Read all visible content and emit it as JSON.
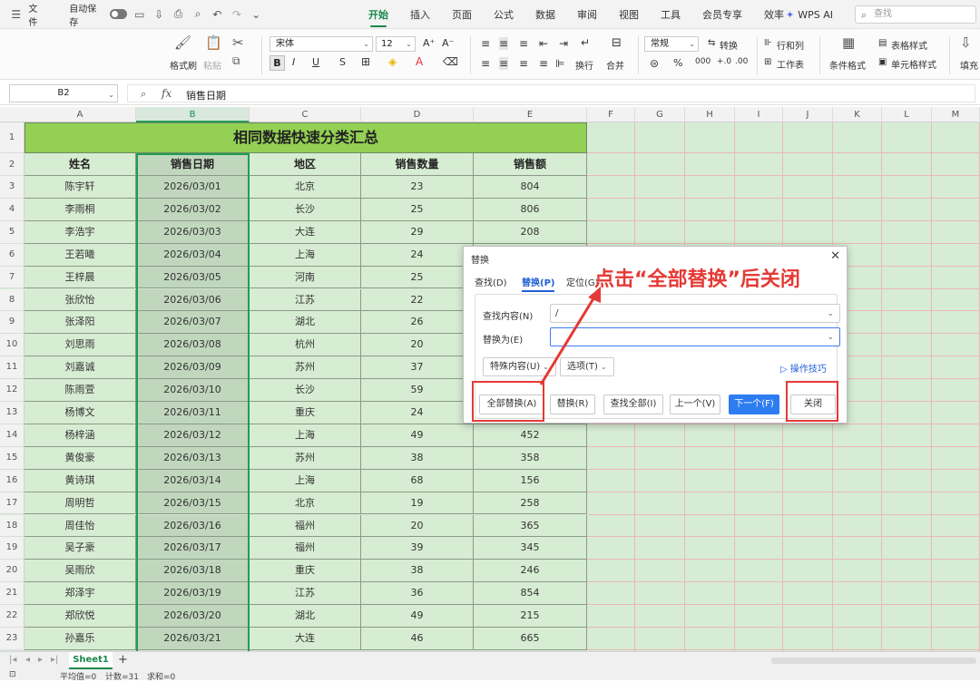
{
  "titlebar": {
    "file": "文件",
    "autosave": "自动保存",
    "tabs": [
      "开始",
      "插入",
      "页面",
      "公式",
      "数据",
      "审阅",
      "视图",
      "工具",
      "会员专享",
      "效率"
    ],
    "wps_ai": "WPS AI",
    "search_placeholder": "查找"
  },
  "ribbon": {
    "format_painter": "格式刷",
    "paste": "粘贴",
    "font_name": "宋体",
    "font_size": "12",
    "number_format": "常规",
    "convert": "转换",
    "wrap": "换行",
    "merge": "合并",
    "row_col": "行和列",
    "worksheet": "工作表",
    "cond_format": "条件格式",
    "table_style": "表格样式",
    "cell_style": "单元格样式",
    "fill": "填充"
  },
  "formula_bar": {
    "cell_ref": "B2",
    "fx": "fx",
    "content": "销售日期"
  },
  "sheet": {
    "col_headers": [
      "A",
      "B",
      "C",
      "D",
      "E",
      "F",
      "G",
      "H",
      "I",
      "J",
      "K",
      "L",
      "M"
    ],
    "row_numbers": [
      "1",
      "2",
      "3",
      "4",
      "5",
      "6",
      "7",
      "8",
      "9",
      "10",
      "11",
      "12",
      "13",
      "14",
      "15",
      "16",
      "17",
      "18",
      "19",
      "20",
      "21",
      "22",
      "23"
    ],
    "title": "相同数据快速分类汇总",
    "headers": [
      "姓名",
      "销售日期",
      "地区",
      "销售数量",
      "销售额"
    ],
    "rows": [
      [
        "陈宇轩",
        "2026/03/01",
        "北京",
        "23",
        "804"
      ],
      [
        "李雨桐",
        "2026/03/02",
        "长沙",
        "25",
        "806"
      ],
      [
        "李浩宇",
        "2026/03/03",
        "大连",
        "29",
        "208"
      ],
      [
        "王若曦",
        "2026/03/04",
        "上海",
        "24",
        ""
      ],
      [
        "王梓晨",
        "2026/03/05",
        "河南",
        "25",
        ""
      ],
      [
        "张欣怡",
        "2026/03/06",
        "江苏",
        "22",
        ""
      ],
      [
        "张泽阳",
        "2026/03/07",
        "湖北",
        "26",
        ""
      ],
      [
        "刘思雨",
        "2026/03/08",
        "杭州",
        "20",
        ""
      ],
      [
        "刘嘉诚",
        "2026/03/09",
        "苏州",
        "37",
        ""
      ],
      [
        "陈雨萱",
        "2026/03/10",
        "长沙",
        "59",
        ""
      ],
      [
        "杨博文",
        "2026/03/11",
        "重庆",
        "24",
        ""
      ],
      [
        "杨梓涵",
        "2026/03/12",
        "上海",
        "49",
        "452"
      ],
      [
        "黄俊豪",
        "2026/03/13",
        "苏州",
        "38",
        "358"
      ],
      [
        "黄诗琪",
        "2026/03/14",
        "上海",
        "68",
        "156"
      ],
      [
        "周明哲",
        "2026/03/15",
        "北京",
        "19",
        "258"
      ],
      [
        "周佳怡",
        "2026/03/16",
        "福州",
        "20",
        "365"
      ],
      [
        "吴子豪",
        "2026/03/17",
        "福州",
        "39",
        "345"
      ],
      [
        "吴雨欣",
        "2026/03/18",
        "重庆",
        "38",
        "246"
      ],
      [
        "郑泽宇",
        "2026/03/19",
        "江苏",
        "36",
        "854"
      ],
      [
        "郑欣悦",
        "2026/03/20",
        "湖北",
        "49",
        "215"
      ],
      [
        "孙嘉乐",
        "2026/03/21",
        "大连",
        "46",
        "665"
      ]
    ],
    "sheet_tab": "Sheet1",
    "status": [
      "平均值=0",
      "计数=31",
      "求和=0"
    ]
  },
  "dialog": {
    "title": "替换",
    "tabs": [
      "查找(D)",
      "替换(P)",
      "定位(G)"
    ],
    "find_label": "查找内容(N)",
    "find_value": "/",
    "replace_label": "替换为(E)",
    "replace_value": "",
    "special": "特殊内容(U)",
    "options": "选项(T)",
    "tips": "操作技巧",
    "buttons": [
      "全部替换(A)",
      "替换(R)",
      "查找全部(I)",
      "上一个(V)",
      "下一个(F)",
      "关闭"
    ]
  },
  "annotation": "点击“全部替换”后关闭",
  "colors": {
    "accent": "#188a4a",
    "title_fill": "#93d053",
    "cell_fill": "#d7edd3",
    "annotation": "#e53935",
    "primary_button": "#2d7cf2"
  }
}
